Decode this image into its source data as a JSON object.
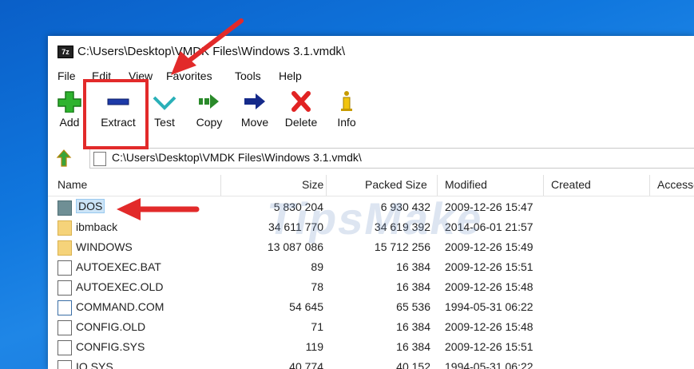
{
  "window": {
    "title": "C:\\Users\\Desktop\\VMDK Files\\Windows 3.1.vmdk\\",
    "app_icon_text": "7z"
  },
  "menu": [
    "File",
    "Edit",
    "View",
    "Favorites",
    "Tools",
    "Help"
  ],
  "toolbar": [
    {
      "label": "Add",
      "icon": "add-icon"
    },
    {
      "label": "Extract",
      "icon": "extract-icon"
    },
    {
      "label": "Test",
      "icon": "test-icon"
    },
    {
      "label": "Copy",
      "icon": "copy-icon"
    },
    {
      "label": "Move",
      "icon": "move-icon"
    },
    {
      "label": "Delete",
      "icon": "delete-icon"
    },
    {
      "label": "Info",
      "icon": "info-icon"
    }
  ],
  "address": {
    "path": "C:\\Users\\Desktop\\VMDK Files\\Windows 3.1.vmdk\\"
  },
  "columns": [
    "Name",
    "Size",
    "Packed Size",
    "Modified",
    "Created",
    "Accessed"
  ],
  "files": [
    {
      "name": "DOS",
      "size": "5 830 204",
      "packed": "6 930 432",
      "modified": "2009-12-26 15:47",
      "type": "folder-dos",
      "selected": true
    },
    {
      "name": "ibmback",
      "size": "34 611 770",
      "packed": "34 619 392",
      "modified": "2014-06-01 21:57",
      "type": "folder"
    },
    {
      "name": "WINDOWS",
      "size": "13 087 086",
      "packed": "15 712 256",
      "modified": "2009-12-26 15:49",
      "type": "folder"
    },
    {
      "name": "AUTOEXEC.BAT",
      "size": "89",
      "packed": "16 384",
      "modified": "2009-12-26 15:51",
      "type": "doc"
    },
    {
      "name": "AUTOEXEC.OLD",
      "size": "78",
      "packed": "16 384",
      "modified": "2009-12-26 15:48",
      "type": "doc"
    },
    {
      "name": "COMMAND.COM",
      "size": "54 645",
      "packed": "65 536",
      "modified": "1994-05-31 06:22",
      "type": "doc"
    },
    {
      "name": "CONFIG.OLD",
      "size": "71",
      "packed": "16 384",
      "modified": "2009-12-26 15:48",
      "type": "doc"
    },
    {
      "name": "CONFIG.SYS",
      "size": "119",
      "packed": "16 384",
      "modified": "2009-12-26 15:51",
      "type": "doc"
    },
    {
      "name": "IO.SYS",
      "size": "40 774",
      "packed": "40 152",
      "modified": "1994-05-31 06:22",
      "type": "doc"
    }
  ],
  "watermark": "TipsMake",
  "colors": {
    "highlight": "#e22a2a",
    "desktop": "#1077de",
    "selection": "#cce4f7"
  }
}
